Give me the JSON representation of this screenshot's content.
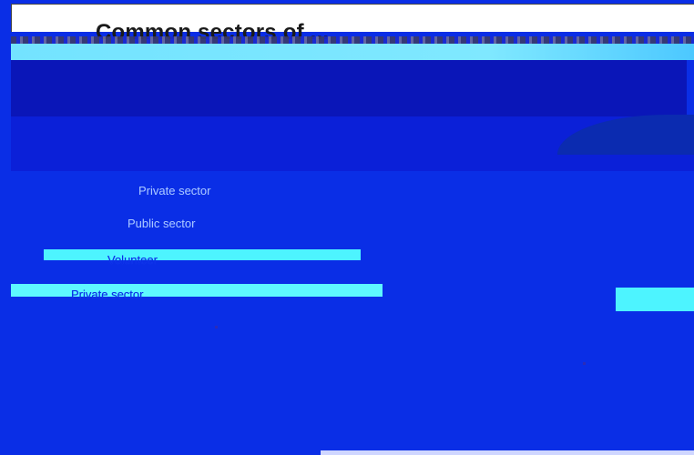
{
  "title": "Common sectors of ...",
  "labels": [
    "Private sector",
    "Public sector",
    "Volunteer",
    "Private sector"
  ]
}
